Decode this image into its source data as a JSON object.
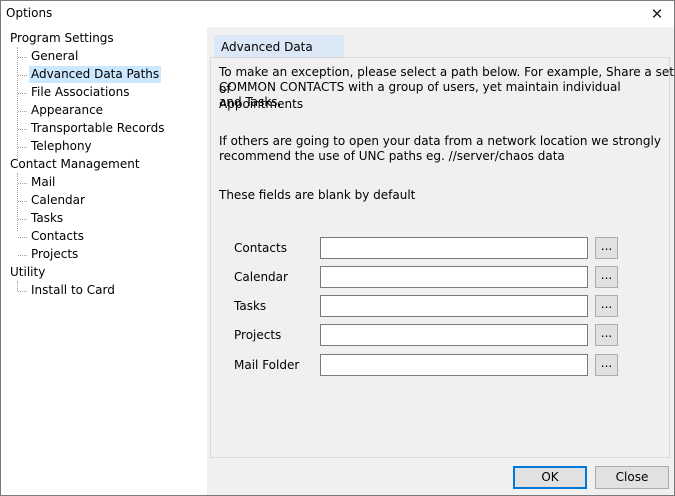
{
  "window": {
    "title": "Options"
  },
  "tree": {
    "program_settings": "Program Settings",
    "program_items": [
      "General",
      "Advanced Data Paths",
      "File Associations",
      "Appearance",
      "Transportable Records",
      "Telephony"
    ],
    "contact_management": "Contact Management",
    "contact_items": [
      "Mail",
      "Calendar",
      "Tasks",
      "Contacts",
      "Projects"
    ],
    "utility": "Utility",
    "utility_items": [
      "Install to Card"
    ],
    "selected": "Advanced Data Paths"
  },
  "tab": {
    "label": "Advanced Data Paths"
  },
  "intro": {
    "line1": "To make an exception, please select a path below.   For example, Share a set of",
    "line2": "COMMON CONTACTS with a group of users, yet maintain individual Appointments",
    "line3": "and Tasks.",
    "unc1": "If others are going to open your data from a network location we strongly",
    "unc2": "recommend the use of UNC paths eg.  //server/chaos data",
    "blank_note": "These fields are blank by default"
  },
  "fields": [
    {
      "label": "Contacts",
      "value": ""
    },
    {
      "label": "Calendar",
      "value": ""
    },
    {
      "label": "Tasks",
      "value": ""
    },
    {
      "label": "Projects",
      "value": ""
    },
    {
      "label": "Mail Folder",
      "value": ""
    }
  ],
  "browse_label": "...",
  "buttons": {
    "ok": "OK",
    "close": "Close"
  }
}
